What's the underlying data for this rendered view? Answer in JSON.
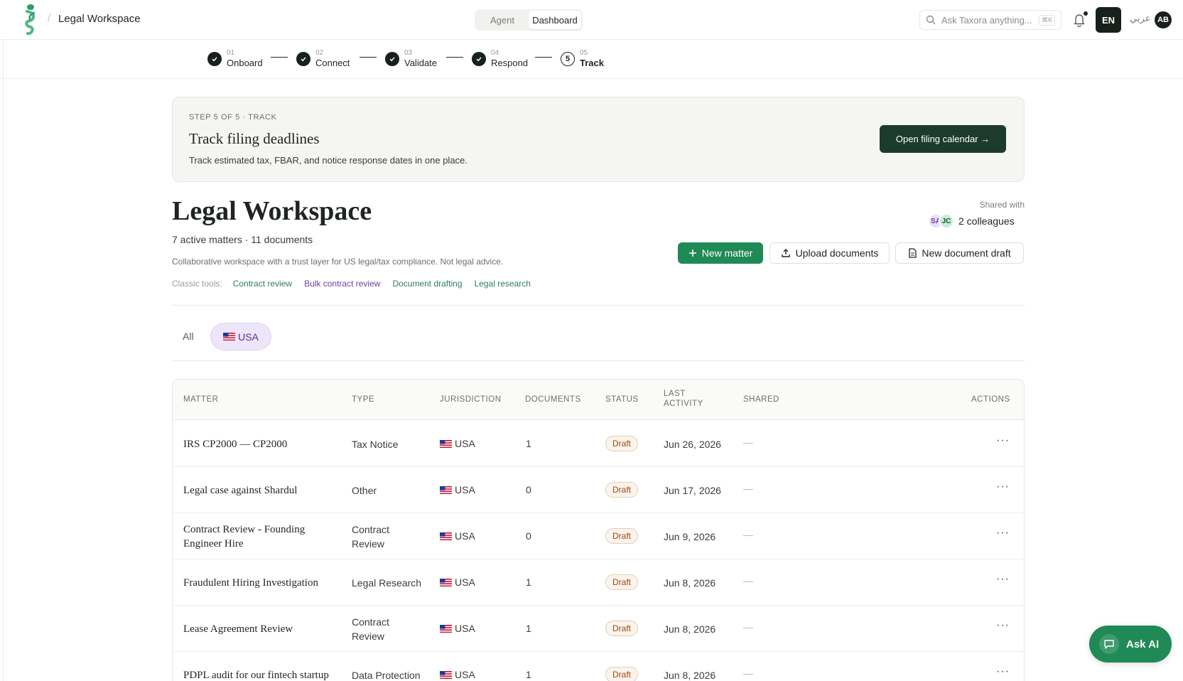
{
  "header": {
    "breadcrumb_sep": "/",
    "breadcrumb": "Legal Workspace",
    "tabs": [
      {
        "label": "Agent"
      },
      {
        "label": "Dashboard"
      }
    ],
    "search_placeholder": "Ask Taxora anything...",
    "search_shortcut": "⌘K",
    "lang_en": "EN",
    "lang_ar": "عربي",
    "avatar": "AB"
  },
  "stepper": [
    {
      "num": "01",
      "label": "Onboard",
      "done": true
    },
    {
      "num": "02",
      "label": "Connect",
      "done": true
    },
    {
      "num": "03",
      "label": "Validate",
      "done": true
    },
    {
      "num": "04",
      "label": "Respond",
      "done": true
    },
    {
      "num": "05",
      "label": "Track",
      "done": false,
      "circle": "5"
    }
  ],
  "banner": {
    "eyebrow": "STEP 5 OF 5 · TRACK",
    "title": "Track filing deadlines",
    "desc": "Track estimated tax, FBAR, and notice response dates in one place.",
    "button": "Open filing calendar →"
  },
  "workspace": {
    "title": "Legal Workspace",
    "subtitle": "7 active matters · 11 documents",
    "desc": "Collaborative workspace with a trust layer for US legal/tax compliance. Not legal advice.",
    "classic_label": "Classic tools:",
    "classic_links": [
      "Contract review",
      "Bulk contract review",
      "Document drafting",
      "Legal research"
    ],
    "shared_label": "Shared with",
    "shared_avatars": [
      "SA",
      "JC"
    ],
    "shared_text": "2 colleagues",
    "btn_new_matter": "New matter",
    "btn_upload": "Upload documents",
    "btn_draft": "New document draft"
  },
  "filters": {
    "all": "All",
    "usa": "USA"
  },
  "table": {
    "headers": {
      "matter": "MATTER",
      "type": "TYPE",
      "jurisdiction": "JURISDICTION",
      "documents": "DOCUMENTS",
      "status": "STATUS",
      "last_activity": "LAST ACTIVITY",
      "shared": "SHARED",
      "actions": "ACTIONS"
    },
    "rows": [
      {
        "matter": "IRS CP2000 — CP2000",
        "type": "Tax Notice",
        "jurisdiction": "USA",
        "documents": "1",
        "status": "Draft",
        "last_activity": "Jun 26, 2026",
        "shared": "—",
        "actions": "···"
      },
      {
        "matter": "Legal case against Shardul",
        "type": "Other",
        "jurisdiction": "USA",
        "documents": "0",
        "status": "Draft",
        "last_activity": "Jun 17, 2026",
        "shared": "—",
        "actions": "···"
      },
      {
        "matter": "Contract Review - Founding Engineer Hire",
        "type": "Contract Review",
        "jurisdiction": "USA",
        "documents": "0",
        "status": "Draft",
        "last_activity": "Jun 9, 2026",
        "shared": "—",
        "actions": "···"
      },
      {
        "matter": "Fraudulent Hiring Investigation",
        "type": "Legal Research",
        "jurisdiction": "USA",
        "documents": "1",
        "status": "Draft",
        "last_activity": "Jun 8, 2026",
        "shared": "—",
        "actions": "···"
      },
      {
        "matter": "Lease Agreement Review",
        "type": "Contract Review",
        "jurisdiction": "USA",
        "documents": "1",
        "status": "Draft",
        "last_activity": "Jun 8, 2026",
        "shared": "—",
        "actions": "···"
      },
      {
        "matter": "PDPL audit for our fintech startup",
        "type": "Data Protection",
        "jurisdiction": "USA",
        "documents": "1",
        "status": "Draft",
        "last_activity": "Jun 8, 2026",
        "shared": "—",
        "actions": "···"
      }
    ]
  },
  "ask_ai": "Ask AI"
}
